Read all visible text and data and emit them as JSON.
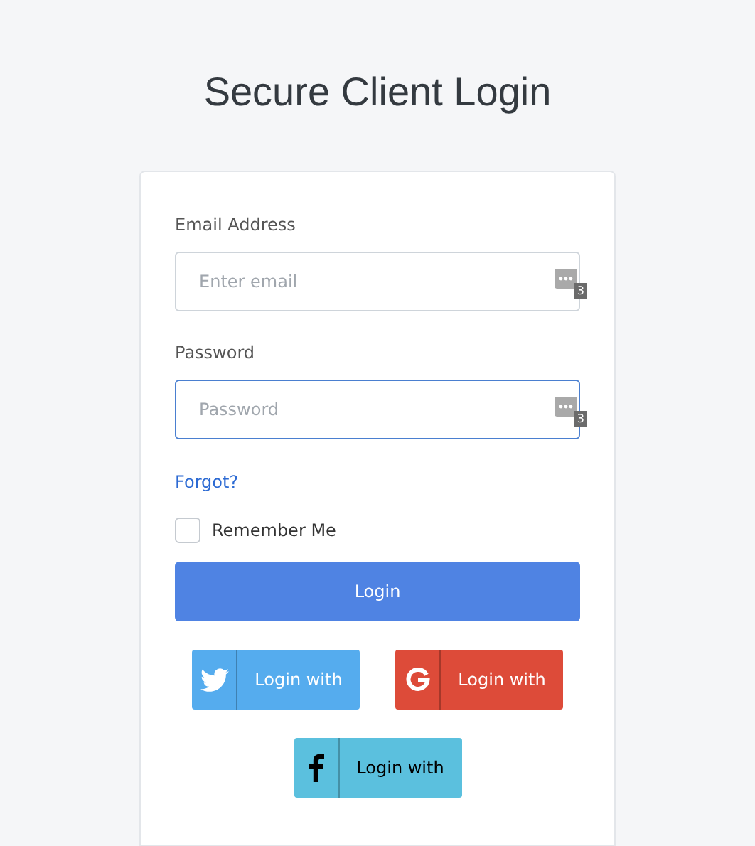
{
  "title": "Secure Client Login",
  "fields": [
    {
      "label": "Email Address",
      "placeholder": "Enter email",
      "focused": false,
      "badge": "3"
    },
    {
      "label": "Password",
      "placeholder": "Password",
      "focused": true,
      "badge": "3"
    }
  ],
  "forgot_link": "Forgot?",
  "remember": {
    "label": "Remember Me",
    "checked": false
  },
  "login_button": "Login",
  "social_buttons": [
    {
      "kind": "twitter",
      "label": "Login with",
      "color": "#55acee"
    },
    {
      "kind": "google",
      "label": "Login with",
      "color": "#dd4b39"
    },
    {
      "kind": "facebook",
      "label": "Login with",
      "color": "#5bc0de"
    }
  ]
}
